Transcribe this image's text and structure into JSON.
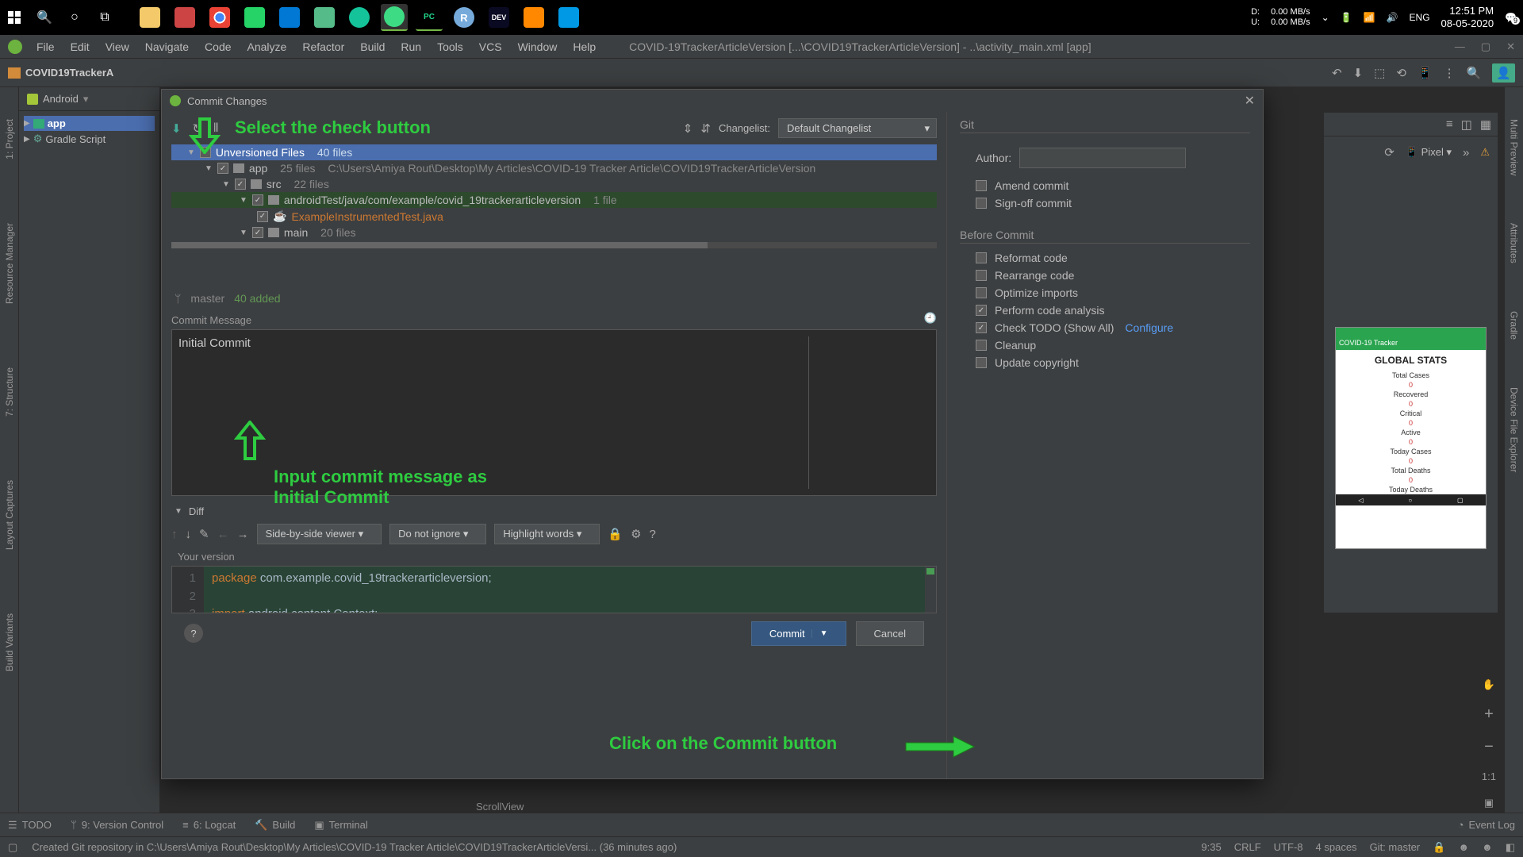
{
  "taskbar": {
    "du_d": "D:",
    "du_u": "U:",
    "speed1": "0.00 MB/s",
    "speed2": "0.00 MB/s",
    "lang": "ENG",
    "time": "12:51 PM",
    "date": "08-05-2020",
    "notif_count": "9"
  },
  "menubar": {
    "items": [
      "File",
      "Edit",
      "View",
      "Navigate",
      "Code",
      "Analyze",
      "Refactor",
      "Build",
      "Run",
      "Tools",
      "VCS",
      "Window",
      "Help"
    ],
    "title": "COVID-19TrackerArticleVersion [...\\COVID19TrackerArticleVersion] - ..\\activity_main.xml [app]"
  },
  "toolbar": {
    "project_name": "COVID19TrackerA"
  },
  "project": {
    "header": "Android",
    "app": "app",
    "gradle": "Gradle Script"
  },
  "left_gutter": [
    "1: Project",
    "Resource Manager",
    "7: Structure",
    "Layout Captures",
    "Build Variants"
  ],
  "right_gutter": [
    "Multi Preview",
    "Attributes",
    "Gradle",
    "Device File Explorer"
  ],
  "dialog": {
    "title": "Commit Changes",
    "changelist_label": "Changelist:",
    "changelist_value": "Default Changelist",
    "tree": {
      "row0": {
        "label": "Unversioned Files",
        "count": "40 files"
      },
      "row1": {
        "label": "app",
        "count": "25 files",
        "path": "C:\\Users\\Amiya Rout\\Desktop\\My Articles\\COVID-19 Tracker Article\\COVID19TrackerArticleVersion"
      },
      "row2": {
        "label": "src",
        "count": "22 files"
      },
      "row3": {
        "label": "androidTest/java/com/example/covid_19trackerarticleversion",
        "count": "1 file"
      },
      "row4": {
        "label": "ExampleInstrumentedTest.java"
      },
      "row5": {
        "label": "main",
        "count": "20 files"
      }
    },
    "branch_icon": "ᛘ",
    "branch": "master",
    "branch_added": "40 added",
    "commit_msg_label": "Commit Message",
    "commit_msg_value": "Initial Commit",
    "diff_label": "Diff",
    "diff_viewer": "Side-by-side viewer",
    "diff_ignore": "Do not ignore",
    "diff_highlight": "Highlight words",
    "your_version": "Your version",
    "code": {
      "l1_kw": "package",
      "l1_rest": "com.example.covid_19trackerarticleversion;",
      "l3_kw": "import",
      "l3_rest": "android.content.Context;"
    },
    "commit_btn": "Commit",
    "cancel_btn": "Cancel"
  },
  "git_panel": {
    "title": "Git",
    "author_label": "Author:",
    "amend": "Amend commit",
    "signoff": "Sign-off commit",
    "before_title": "Before Commit",
    "reformat": "Reformat code",
    "rearrange": "Rearrange code",
    "optimize": "Optimize imports",
    "analysis": "Perform code analysis",
    "todo": "Check TODO (Show All)",
    "configure": "Configure",
    "cleanup": "Cleanup",
    "copyright": "Update copyright"
  },
  "annotations": {
    "select_check": "Select the check button",
    "input_msg_l1": "Input commit message as",
    "input_msg_l2": "Initial Commit",
    "click_commit": "Click on the Commit button"
  },
  "preview": {
    "device": "Pixel",
    "zoom": "1:1",
    "app_title": "COVID-19 Tracker",
    "header": "GLOBAL STATS",
    "rows": [
      "Total Cases",
      "Recovered",
      "Critical",
      "Active",
      "Today Cases",
      "Total Deaths",
      "Today Deaths"
    ],
    "zero": "0"
  },
  "bottom_tabs": {
    "todo": "TODO",
    "vc": "9: Version Control",
    "logcat": "6: Logcat",
    "build": "Build",
    "terminal": "Terminal",
    "event_log": "Event Log"
  },
  "status": {
    "msg": "Created Git repository in C:\\Users\\Amiya Rout\\Desktop\\My Articles\\COVID-19 Tracker Article\\COVID19TrackerArticleVersi... (36 minutes ago)",
    "col": "9:35",
    "crlf": "CRLF",
    "enc": "UTF-8",
    "spaces": "4 spaces",
    "git": "Git: master"
  },
  "scrollview": "ScrollView"
}
